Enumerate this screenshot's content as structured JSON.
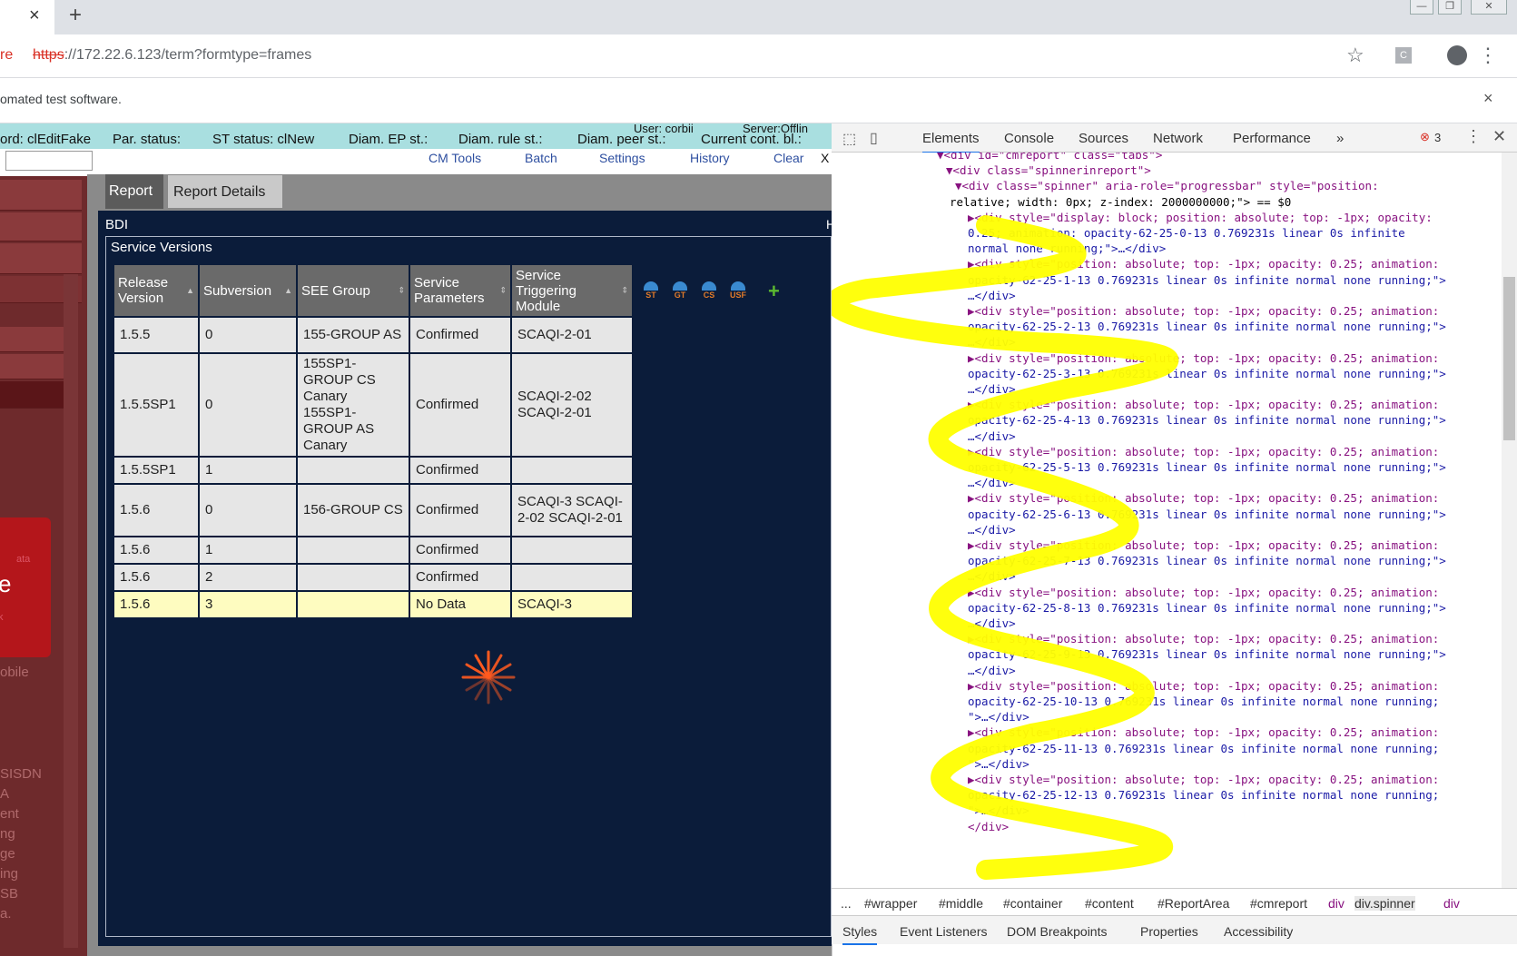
{
  "browser": {
    "tab_close": "×",
    "new_tab": "+",
    "not_secure": "re",
    "url_scheme": "https",
    "url_rest": "://172.22.6.123/term?formtype=frames",
    "ext_letter": "C",
    "info_text": "omated test software.",
    "info_close": "×",
    "win_min": "—",
    "win_max": "❐",
    "win_close": "✕"
  },
  "status": {
    "record": "ord: clEditFake",
    "par": "Par. status:",
    "st": "ST status: clNew",
    "diam_ep": "Diam. EP st.:",
    "diam_rule": "Diam. rule st.:",
    "diam_peer": "Diam. peer st.:",
    "cont": "Current cont. bl.:",
    "user": "User: corbii",
    "server": "Server:Offlin"
  },
  "topnav": {
    "cm_tools": "CM Tools",
    "batch": "Batch",
    "settings": "Settings",
    "history": "History",
    "clear": "Clear",
    "close": "X"
  },
  "sidebar": {
    "red_small": "ata",
    "red_big": "e",
    "red_tiny": "k",
    "items": [
      "obile",
      "SISDN",
      "A",
      "ent",
      "ng",
      "ge",
      "ing",
      "SB",
      "a."
    ]
  },
  "tabs": {
    "report": "Report",
    "report_details": "Report Details"
  },
  "bdi": {
    "title": "BDI",
    "h": "H"
  },
  "service_versions": {
    "title": "Service Versions",
    "columns": [
      "Release Version",
      "Subversion",
      "SEE Group",
      "Service Parameters",
      "Service Triggering Module"
    ],
    "rows": [
      {
        "release": "1.5.5",
        "sub": "0",
        "group": "155-GROUP AS",
        "params": "Confirmed",
        "module": "SCAQI-2-01"
      },
      {
        "release": "1.5.5SP1",
        "sub": "0",
        "group": "155SP1-GROUP CS Canary 155SP1-GROUP AS Canary",
        "params": "Confirmed",
        "module": "SCAQI-2-02 SCAQI-2-01"
      },
      {
        "release": "1.5.5SP1",
        "sub": "1",
        "group": "",
        "params": "Confirmed",
        "module": ""
      },
      {
        "release": "1.5.6",
        "sub": "0",
        "group": "156-GROUP CS",
        "params": "Confirmed",
        "module": "SCAQI-3 SCAQI-2-02 SCAQI-2-01"
      },
      {
        "release": "1.5.6",
        "sub": "1",
        "group": "",
        "params": "Confirmed",
        "module": ""
      },
      {
        "release": "1.5.6",
        "sub": "2",
        "group": "",
        "params": "Confirmed",
        "module": ""
      },
      {
        "release": "1.5.6",
        "sub": "3",
        "group": "",
        "params": "No Data",
        "module": "SCAQI-3"
      }
    ],
    "icons": [
      "ST",
      "GT",
      "CS",
      "USF",
      "+"
    ]
  },
  "devtools": {
    "tabs": [
      "Elements",
      "Console",
      "Sources",
      "Network",
      "Performance",
      "»"
    ],
    "errors": "3",
    "lines": [
      "▼<div id=\"cmreport\" class=\"tabs\">",
      "▼<div class=\"spinnerinreport\">",
      "▼<div class=\"spinner\" aria-role=\"progressbar\" style=\"position:",
      "relative; width: 0px; z-index: 2000000000;\"> == $0",
      "▶<div style=\"display: block; position: absolute; top: -1px; opacity:",
      "0.25; animation: opacity-62-25-0-13 0.769231s linear 0s infinite",
      "normal none running;\">…</div>",
      "▶<div style=\"position: absolute; top: -1px; opacity: 0.25; animation:",
      "opacity-62-25-1-13 0.769231s linear 0s infinite normal none running;\">",
      "…</div>",
      "▶<div style=\"position: absolute; top: -1px; opacity: 0.25; animation:",
      "opacity-62-25-2-13 0.769231s linear 0s infinite normal none running;\">",
      "…</div>",
      "▶<div style=\"position: absolute; top: -1px; opacity: 0.25; animation:",
      "opacity-62-25-3-13 0.769231s linear 0s infinite normal none running;\">",
      "…</div>",
      "▶<div style=\"position: absolute; top: -1px; opacity: 0.25; animation:",
      "opacity-62-25-4-13 0.769231s linear 0s infinite normal none running;\">",
      "…</div>",
      "▶<div style=\"position: absolute; top: -1px; opacity: 0.25; animation:",
      "opacity-62-25-5-13 0.769231s linear 0s infinite normal none running;\">",
      "…</div>",
      "▶<div style=\"position: absolute; top: -1px; opacity: 0.25; animation:",
      "opacity-62-25-6-13 0.769231s linear 0s infinite normal none running;\">",
      "…</div>",
      "▶<div style=\"position: absolute; top: -1px; opacity: 0.25; animation:",
      "opacity-62-25-7-13 0.769231s linear 0s infinite normal none running;\">",
      "…</div>",
      "▶<div style=\"position: absolute; top: -1px; opacity: 0.25; animation:",
      "opacity-62-25-8-13 0.769231s linear 0s infinite normal none running;\">",
      "…</div>",
      "▶<div style=\"position: absolute; top: -1px; opacity: 0.25; animation:",
      "opacity-62-25-9-13 0.769231s linear 0s infinite normal none running;\">",
      "…</div>",
      "▶<div style=\"position: absolute; top: -1px; opacity: 0.25; animation:",
      "opacity-62-25-10-13 0.769231s linear 0s infinite normal none running;",
      "\">…</div>",
      "▶<div style=\"position: absolute; top: -1px; opacity: 0.25; animation:",
      "opacity-62-25-11-13 0.769231s linear 0s infinite normal none running;",
      "\">…</div>",
      "▶<div style=\"position: absolute; top: -1px; opacity: 0.25; animation:",
      "opacity-62-25-12-13 0.769231s linear 0s infinite normal none running;",
      "\">…</div>",
      "</div>"
    ],
    "crumbs": [
      "...",
      "#wrapper",
      "#middle",
      "#container",
      "#content",
      "#ReportArea",
      "#cmreport",
      "div",
      "div.spinner",
      "div"
    ],
    "lower_tabs": [
      "Styles",
      "Event Listeners",
      "DOM Breakpoints",
      "Properties",
      "Accessibility"
    ]
  }
}
